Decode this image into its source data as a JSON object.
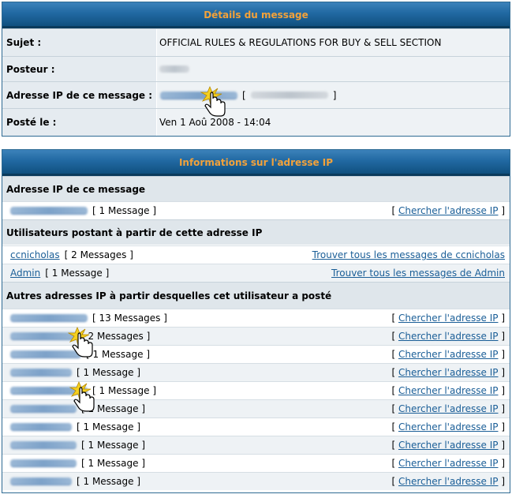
{
  "details": {
    "title": "Détails du message",
    "subject_label": "Sujet :",
    "subject_value": "OFFICIAL RULES & REGULATIONS FOR BUY & SELL SECTION",
    "poster_label": "Posteur :",
    "ip_label": "Adresse IP de ce message :",
    "ip_bracket_open": "[",
    "ip_bracket_close": "]",
    "posted_label": "Posté le :",
    "posted_value": "Ven 1 Aoû 2008 - 14:04"
  },
  "ipinfo": {
    "title": "Informations sur l'adresse IP",
    "section_this_ip": "Adresse IP de ce message",
    "this_ip_count": "[ 1 Message ]",
    "search_ip_label": "Chercher l'adresse IP",
    "bracket_open": "[",
    "bracket_close": "]",
    "section_users": "Utilisateurs postant à partir de cette adresse IP",
    "users": [
      {
        "name": "ccnicholas",
        "count": "[ 2 Messages ]",
        "find_label": "Trouver tous les messages de ccnicholas"
      },
      {
        "name": "Admin",
        "count": "[ 1 Message ]",
        "find_label": "Trouver tous les messages de Admin"
      }
    ],
    "section_other_ips": "Autres adresses IP à partir desquelles cet utilisateur a posté",
    "other_ips": [
      {
        "count": "[ 13 Messages ]"
      },
      {
        "count": "[ 2 Messages ]"
      },
      {
        "count": "[ 1 Message ]"
      },
      {
        "count": "[ 1 Message ]"
      },
      {
        "count": "[ 1 Message ]"
      },
      {
        "count": "[ 1 Message ]"
      },
      {
        "count": "[ 1 Message ]"
      },
      {
        "count": "[ 1 Message ]"
      },
      {
        "count": "[ 1 Message ]"
      },
      {
        "count": "[ 1 Message ]"
      }
    ]
  },
  "colors": {
    "header_text": "#f3a23a",
    "header_bg": "#2169a2",
    "link": "#1a5e97",
    "row_alt": "#eef2f5",
    "label_bg": "#e5ebf0"
  },
  "icons": [
    "hand-cursor-icon",
    "click-burst-icon"
  ]
}
